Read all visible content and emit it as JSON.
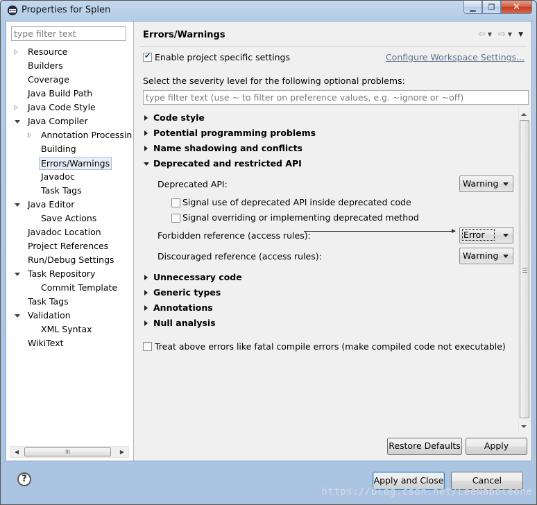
{
  "window": {
    "title": "Properties for Splen",
    "minimize_glyph": "▁",
    "restore_glyph": "❐",
    "close_glyph": "✕"
  },
  "left": {
    "filter_placeholder": "type filter text",
    "tree": [
      {
        "label": "Resource",
        "level": 0,
        "twisty": "closed"
      },
      {
        "label": "Builders",
        "level": 0,
        "twisty": "none"
      },
      {
        "label": "Coverage",
        "level": 0,
        "twisty": "none"
      },
      {
        "label": "Java Build Path",
        "level": 0,
        "twisty": "none"
      },
      {
        "label": "Java Code Style",
        "level": 0,
        "twisty": "closed"
      },
      {
        "label": "Java Compiler",
        "level": 0,
        "twisty": "open"
      },
      {
        "label": "Annotation Processin",
        "level": 1,
        "twisty": "closed"
      },
      {
        "label": "Building",
        "level": 1,
        "twisty": "none"
      },
      {
        "label": "Errors/Warnings",
        "level": 1,
        "twisty": "none",
        "selected": true
      },
      {
        "label": "Javadoc",
        "level": 1,
        "twisty": "none"
      },
      {
        "label": "Task Tags",
        "level": 1,
        "twisty": "none"
      },
      {
        "label": "Java Editor",
        "level": 0,
        "twisty": "open"
      },
      {
        "label": "Save Actions",
        "level": 1,
        "twisty": "none"
      },
      {
        "label": "Javadoc Location",
        "level": 0,
        "twisty": "none"
      },
      {
        "label": "Project References",
        "level": 0,
        "twisty": "none"
      },
      {
        "label": "Run/Debug Settings",
        "level": 0,
        "twisty": "none"
      },
      {
        "label": "Task Repository",
        "level": 0,
        "twisty": "open"
      },
      {
        "label": "Commit Template",
        "level": 1,
        "twisty": "none"
      },
      {
        "label": "Task Tags",
        "level": 0,
        "twisty": "none"
      },
      {
        "label": "Validation",
        "level": 0,
        "twisty": "open"
      },
      {
        "label": "XML Syntax",
        "level": 1,
        "twisty": "none"
      },
      {
        "label": "WikiText",
        "level": 0,
        "twisty": "none"
      }
    ],
    "hscroll_left": "◀",
    "hscroll_right": "▶",
    "hscroll_grip": "III"
  },
  "main": {
    "title": "Errors/Warnings",
    "nav": {
      "back": "⇦",
      "forward": "⇨",
      "dropdown": "▼",
      "menu": "▼"
    },
    "enable_label": "Enable project specific settings",
    "enable_checked": true,
    "configure_link": "Configure Workspace Settings...",
    "severity_prompt": "Select the severity level for the following optional problems:",
    "filter_placeholder": "type filter text (use ~ to filter on preference values, e.g. ~ignore or ~off)",
    "sections": [
      {
        "label": "Code style",
        "expanded": false
      },
      {
        "label": "Potential programming problems",
        "expanded": false
      },
      {
        "label": "Name shadowing and conflicts",
        "expanded": false
      },
      {
        "label": "Deprecated and restricted API",
        "expanded": true
      },
      {
        "label": "Unnecessary code",
        "expanded": false
      },
      {
        "label": "Generic types",
        "expanded": false
      },
      {
        "label": "Annotations",
        "expanded": false
      },
      {
        "label": "Null analysis",
        "expanded": false
      }
    ],
    "deprecated": {
      "deprecated_api_label": "Deprecated API:",
      "deprecated_api_value": "Warning",
      "signal_inside_label": "Signal use of deprecated API inside deprecated code",
      "signal_inside_checked": false,
      "signal_overriding_label": "Signal overriding or implementing deprecated method",
      "signal_overriding_checked": false,
      "forbidden_label": "Forbidden reference (access rules):",
      "forbidden_value": "Error",
      "discouraged_label": "Discouraged reference (access rules):",
      "discouraged_value": "Warning"
    },
    "treat_label": "Treat above errors like fatal compile errors (make compiled code not executable)",
    "treat_checked": false,
    "restore_defaults": "Restore Defaults",
    "apply": "Apply"
  },
  "footer": {
    "help_glyph": "?",
    "apply_and_close": "Apply and Close",
    "cancel": "Cancel"
  },
  "watermark": "https://blog.csdn.net/LeeNapoleone"
}
